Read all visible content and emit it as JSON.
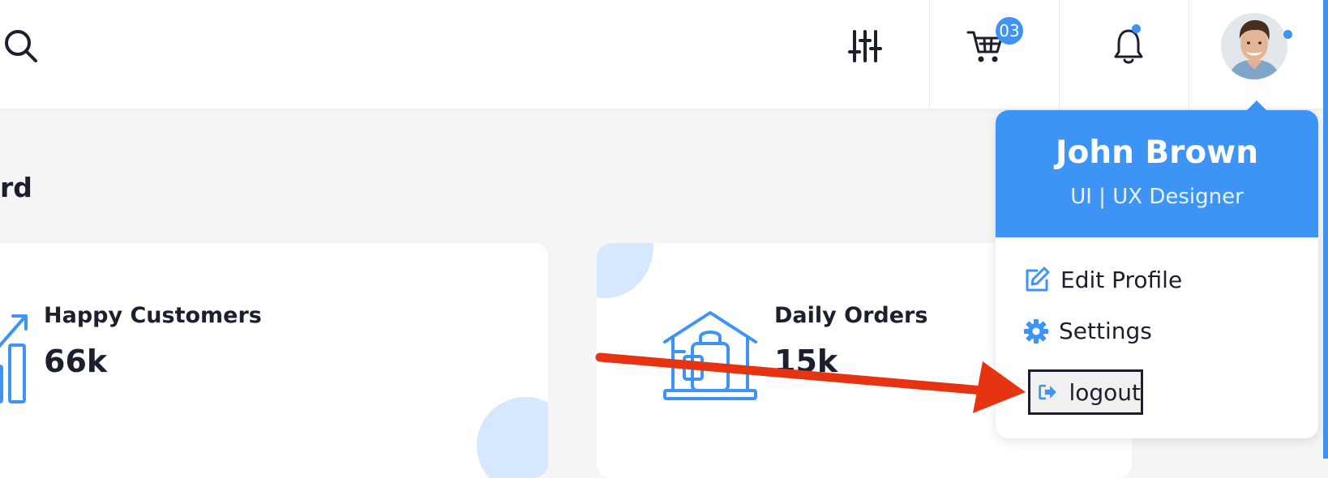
{
  "header": {
    "search_icon": "search-icon",
    "filter_icon": "sliders-icon",
    "cart_icon": "cart-icon",
    "cart_badge": "03",
    "bell_icon": "bell-icon",
    "accent_color": "#3d94f5"
  },
  "page": {
    "heading_partial": "rd"
  },
  "cards": [
    {
      "label": "Happy Customers",
      "value": "66k",
      "icon": "growth-chart-icon"
    },
    {
      "label": "Daily Orders",
      "value": "15k",
      "icon": "house-bag-icon"
    }
  ],
  "profile_menu": {
    "name": "John Brown",
    "role": "UI | UX Designer",
    "items": [
      {
        "label": "Edit Profile",
        "icon": "edit-icon"
      },
      {
        "label": "Settings",
        "icon": "gear-icon"
      },
      {
        "label": "logout",
        "icon": "sign-out-icon"
      }
    ]
  },
  "annotation": {
    "arrow_color": "#e63312"
  }
}
